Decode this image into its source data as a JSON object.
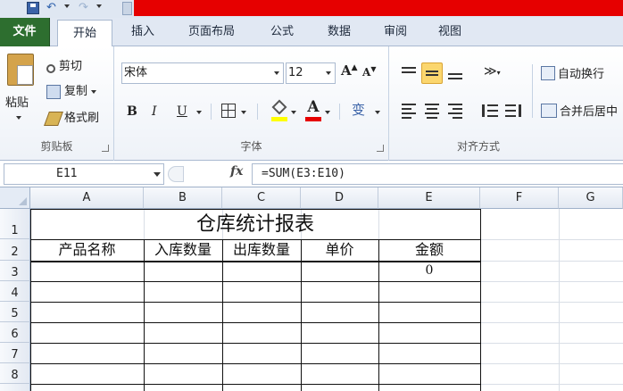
{
  "ribbon_tabs": {
    "file": "文件",
    "home": "开始",
    "insert": "插入",
    "page_layout": "页面布局",
    "formulas": "公式",
    "data": "数据",
    "review": "审阅",
    "view": "视图"
  },
  "clipboard": {
    "paste": "粘贴",
    "cut": "剪切",
    "copy": "复制",
    "format_painter": "格式刷",
    "group_label": "剪贴板"
  },
  "font": {
    "font_name": "宋体",
    "font_size": "12",
    "grow": "A",
    "shrink": "A",
    "bold": "B",
    "italic": "I",
    "underline": "U",
    "font_color_glyph": "A",
    "phonetic_glyph": "变",
    "group_label": "字体"
  },
  "alignment": {
    "wrap_text": "自动换行",
    "merge_center": "合并后居中",
    "group_label": "对齐方式"
  },
  "formula_bar": {
    "name_box": "E11",
    "fx": "fx",
    "formula": "=SUM(E3:E10)"
  },
  "sheet": {
    "columns": [
      "A",
      "B",
      "C",
      "D",
      "E",
      "F",
      "G"
    ],
    "rows": [
      "1",
      "2",
      "3",
      "4",
      "5",
      "6",
      "7",
      "8"
    ],
    "title": "仓库统计报表",
    "headers": [
      "产品名称",
      "入库数量",
      "出库数量",
      "单价",
      "金额"
    ],
    "e3_value": "0"
  },
  "colors": {
    "file_tab": "#2d6e2f",
    "title_bar_highlight": "#e60000",
    "fill_color": "#ffff00",
    "font_color": "#e60000",
    "selected_align": "#fbd66e"
  }
}
